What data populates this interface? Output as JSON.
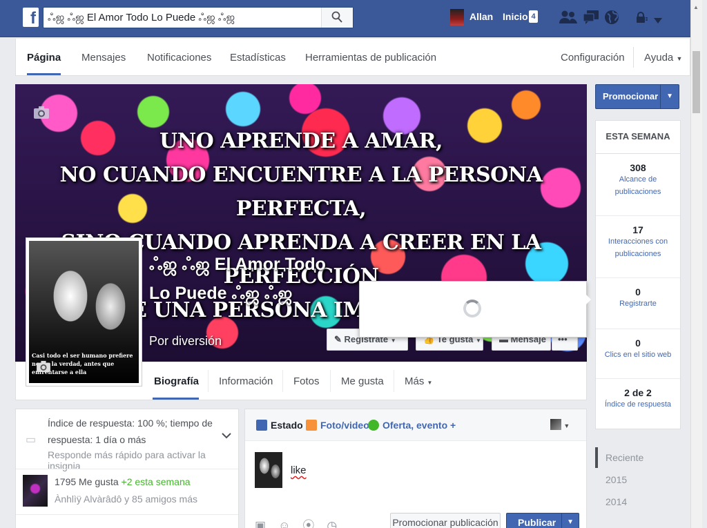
{
  "topbar": {
    "logo": "f",
    "search_text": "ஃஜ ஃஜ El Amor Todo Lo Puede ஃஜ ஃஜ",
    "user_name": "Allan",
    "home_label": "Inicio",
    "home_count": "4",
    "icons": [
      "friends-icon",
      "messages-icon",
      "globe-icon",
      "privacy-lock-icon",
      "account-menu-icon"
    ]
  },
  "admin_nav": {
    "items": [
      "Página",
      "Mensajes",
      "Notificaciones",
      "Estadísticas",
      "Herramientas de publicación"
    ],
    "settings": "Configuración",
    "help": "Ayuda"
  },
  "cover": {
    "quote_lines": [
      "UNO APRENDE A AMAR,",
      "NO CUANDO ENCUENTRE A LA PERSONA PERFECTA,",
      "SINO CUANDO APRENDA A CREER EN LA PERFECCIÓN",
      "DE UNA PERSONA IMPERFECTA"
    ],
    "page_name": "ஃஜ ஃஜ El Amor Todo Lo Puede ஃஜ ஃஜ",
    "category": "Por diversión",
    "btn_register": "Regístrate",
    "btn_like": "Te gusta",
    "btn_message": "Mensaje",
    "btn_more": "•••"
  },
  "profile": {
    "pic_text": "Casi todo el ser humano prefiere negar la verdad, antes que enfrentarse a ella"
  },
  "timeline_nav": {
    "items": [
      "Biografía",
      "Información",
      "Fotos",
      "Me gusta",
      "Más"
    ]
  },
  "promote": {
    "label": "Promocionar"
  },
  "this_week": {
    "title": "ESTA SEMANA",
    "stats": [
      {
        "num": "308",
        "label": "Alcance de publicaciones"
      },
      {
        "num": "17",
        "label": "Interacciones con publicaciones"
      },
      {
        "num": "0",
        "label": "Registrarte"
      },
      {
        "num": "0",
        "label": "Clics en el sitio web"
      },
      {
        "num": "2 de 2",
        "label": "Índice de respuesta"
      }
    ]
  },
  "years": [
    "Reciente",
    "2015",
    "2014"
  ],
  "response": {
    "text": "Índice de respuesta: 100 %; tiempo de respuesta: 1 día o más",
    "hint": "Responde más rápido para activar la insignia",
    "likes": "1795 Me gusta",
    "likes_delta": "+2 esta semana",
    "friends": "Ànhlìÿ Alvàrâdô y 85 amigos más"
  },
  "composer": {
    "tab_status": "Estado",
    "tab_photo": "Foto/video",
    "tab_offer": "Oferta, evento +",
    "text": "like",
    "boost": "Promocionar publicación",
    "publish": "Publicar"
  },
  "colors": {
    "brand": "#3b5998",
    "accent": "#4267b2",
    "positive": "#42b72a"
  }
}
